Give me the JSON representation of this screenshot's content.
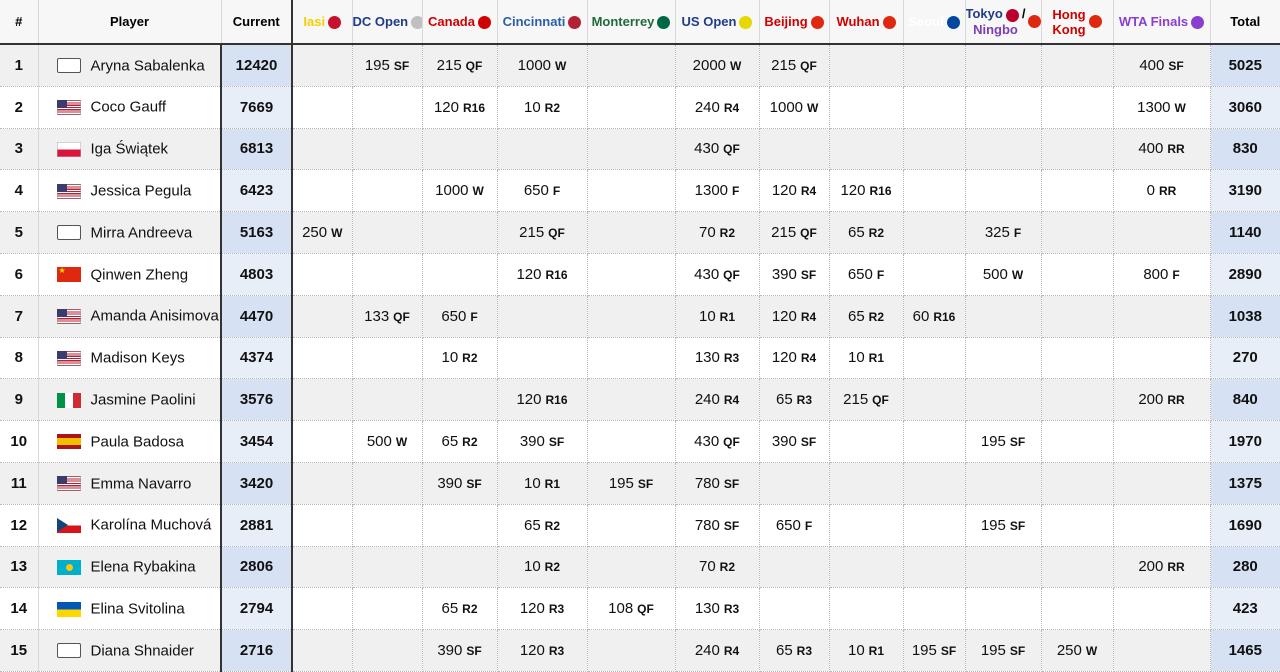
{
  "headers": {
    "rank": "#",
    "player": "Player",
    "current": "Current",
    "total": "Total",
    "events": [
      {
        "name": "Iasi",
        "color": "#f5d000",
        "icon_color": "#c8102e"
      },
      {
        "name": "DC Open",
        "color": "#1f3c88",
        "icon_color": "#c0c0c0"
      },
      {
        "name": "Canada",
        "color": "#d00000",
        "icon_color": "#d00000"
      },
      {
        "name": "Cincinnati",
        "color": "#2b5fa8",
        "icon_color": "#b22234"
      },
      {
        "name": "Monterrey",
        "color": "#1f6b3a",
        "icon_color": "#006847"
      },
      {
        "name": "US Open",
        "color": "#1f3c88",
        "icon_color": "#e6d800"
      },
      {
        "name": "Beijing",
        "color": "#d00000",
        "icon_color": "#de2910"
      },
      {
        "name": "Wuhan",
        "color": "#d00000",
        "icon_color": "#de2910"
      },
      {
        "name": "Seoul",
        "color": "#ffffff",
        "icon_color": "#0047a0"
      },
      {
        "name_top": "Tokyo",
        "name_sep": "/",
        "name_bottom": "Ningbo",
        "color_top": "#1f3c88",
        "color_bottom": "#7b3fb5",
        "icon_top": "#bc002d",
        "icon_bottom": "#de2910"
      },
      {
        "name_top": "Hong",
        "name_bottom": "Kong",
        "color": "#d00000",
        "icon_color": "#de2910"
      },
      {
        "name": "WTA Finals",
        "color": "#8a3fd1",
        "icon_color": "#8a3fd1"
      }
    ]
  },
  "rows": [
    {
      "rank": "1",
      "flag": "blank",
      "name": "Aryna Sabalenka",
      "current": "12420",
      "results": [
        null,
        {
          "pts": "195",
          "rd": "SF"
        },
        {
          "pts": "215",
          "rd": "QF"
        },
        {
          "pts": "1000",
          "rd": "W"
        },
        null,
        {
          "pts": "2000",
          "rd": "W"
        },
        {
          "pts": "215",
          "rd": "QF"
        },
        null,
        null,
        null,
        null,
        {
          "pts": "400",
          "rd": "SF"
        }
      ],
      "total": "5025"
    },
    {
      "rank": "2",
      "flag": "us",
      "name": "Coco Gauff",
      "current": "7669",
      "results": [
        null,
        null,
        {
          "pts": "120",
          "rd": "R16"
        },
        {
          "pts": "10",
          "rd": "R2"
        },
        null,
        {
          "pts": "240",
          "rd": "R4"
        },
        {
          "pts": "1000",
          "rd": "W"
        },
        null,
        null,
        null,
        null,
        {
          "pts": "1300",
          "rd": "W"
        }
      ],
      "total": "3060"
    },
    {
      "rank": "3",
      "flag": "pl",
      "name": "Iga Świątek",
      "current": "6813",
      "results": [
        null,
        null,
        null,
        null,
        null,
        {
          "pts": "430",
          "rd": "QF"
        },
        null,
        null,
        null,
        null,
        null,
        {
          "pts": "400",
          "rd": "RR"
        }
      ],
      "total": "830"
    },
    {
      "rank": "4",
      "flag": "us",
      "name": "Jessica Pegula",
      "current": "6423",
      "results": [
        null,
        null,
        {
          "pts": "1000",
          "rd": "W"
        },
        {
          "pts": "650",
          "rd": "F"
        },
        null,
        {
          "pts": "1300",
          "rd": "F"
        },
        {
          "pts": "120",
          "rd": "R4"
        },
        {
          "pts": "120",
          "rd": "R16"
        },
        null,
        null,
        null,
        {
          "pts": "0",
          "rd": "RR"
        }
      ],
      "total": "3190"
    },
    {
      "rank": "5",
      "flag": "blank",
      "name": "Mirra Andreeva",
      "current": "5163",
      "results": [
        {
          "pts": "250",
          "rd": "W"
        },
        null,
        null,
        {
          "pts": "215",
          "rd": "QF"
        },
        null,
        {
          "pts": "70",
          "rd": "R2"
        },
        {
          "pts": "215",
          "rd": "QF"
        },
        {
          "pts": "65",
          "rd": "R2"
        },
        null,
        {
          "pts": "325",
          "rd": "F"
        },
        null,
        null
      ],
      "total": "1140"
    },
    {
      "rank": "6",
      "flag": "cn",
      "name": "Qinwen Zheng",
      "current": "4803",
      "results": [
        null,
        null,
        null,
        {
          "pts": "120",
          "rd": "R16"
        },
        null,
        {
          "pts": "430",
          "rd": "QF"
        },
        {
          "pts": "390",
          "rd": "SF"
        },
        {
          "pts": "650",
          "rd": "F"
        },
        null,
        {
          "pts": "500",
          "rd": "W"
        },
        null,
        {
          "pts": "800",
          "rd": "F"
        }
      ],
      "total": "2890"
    },
    {
      "rank": "7",
      "flag": "us",
      "name": "Amanda Anisimova",
      "current": "4470",
      "results": [
        null,
        {
          "pts": "133",
          "rd": "QF"
        },
        {
          "pts": "650",
          "rd": "F"
        },
        null,
        null,
        {
          "pts": "10",
          "rd": "R1"
        },
        {
          "pts": "120",
          "rd": "R4"
        },
        {
          "pts": "65",
          "rd": "R2"
        },
        {
          "pts": "60",
          "rd": "R16"
        },
        null,
        null,
        null
      ],
      "total": "1038"
    },
    {
      "rank": "8",
      "flag": "us",
      "name": "Madison Keys",
      "current": "4374",
      "results": [
        null,
        null,
        {
          "pts": "10",
          "rd": "R2"
        },
        null,
        null,
        {
          "pts": "130",
          "rd": "R3"
        },
        {
          "pts": "120",
          "rd": "R4"
        },
        {
          "pts": "10",
          "rd": "R1"
        },
        null,
        null,
        null,
        null
      ],
      "total": "270"
    },
    {
      "rank": "9",
      "flag": "it",
      "name": "Jasmine Paolini",
      "current": "3576",
      "results": [
        null,
        null,
        null,
        {
          "pts": "120",
          "rd": "R16"
        },
        null,
        {
          "pts": "240",
          "rd": "R4"
        },
        {
          "pts": "65",
          "rd": "R3"
        },
        {
          "pts": "215",
          "rd": "QF"
        },
        null,
        null,
        null,
        {
          "pts": "200",
          "rd": "RR"
        }
      ],
      "total": "840"
    },
    {
      "rank": "10",
      "flag": "es",
      "name": "Paula Badosa",
      "current": "3454",
      "results": [
        null,
        {
          "pts": "500",
          "rd": "W"
        },
        {
          "pts": "65",
          "rd": "R2"
        },
        {
          "pts": "390",
          "rd": "SF"
        },
        null,
        {
          "pts": "430",
          "rd": "QF"
        },
        {
          "pts": "390",
          "rd": "SF"
        },
        null,
        null,
        {
          "pts": "195",
          "rd": "SF"
        },
        null,
        null
      ],
      "total": "1970"
    },
    {
      "rank": "11",
      "flag": "us",
      "name": "Emma Navarro",
      "current": "3420",
      "results": [
        null,
        null,
        {
          "pts": "390",
          "rd": "SF"
        },
        {
          "pts": "10",
          "rd": "R1"
        },
        {
          "pts": "195",
          "rd": "SF"
        },
        {
          "pts": "780",
          "rd": "SF"
        },
        null,
        null,
        null,
        null,
        null,
        null
      ],
      "total": "1375"
    },
    {
      "rank": "12",
      "flag": "cz",
      "name": "Karolína Muchová",
      "current": "2881",
      "results": [
        null,
        null,
        null,
        {
          "pts": "65",
          "rd": "R2"
        },
        null,
        {
          "pts": "780",
          "rd": "SF"
        },
        {
          "pts": "650",
          "rd": "F"
        },
        null,
        null,
        {
          "pts": "195",
          "rd": "SF"
        },
        null,
        null
      ],
      "total": "1690"
    },
    {
      "rank": "13",
      "flag": "kz",
      "name": "Elena Rybakina",
      "current": "2806",
      "results": [
        null,
        null,
        null,
        {
          "pts": "10",
          "rd": "R2"
        },
        null,
        {
          "pts": "70",
          "rd": "R2"
        },
        null,
        null,
        null,
        null,
        null,
        {
          "pts": "200",
          "rd": "RR"
        }
      ],
      "total": "280"
    },
    {
      "rank": "14",
      "flag": "ua",
      "name": "Elina Svitolina",
      "current": "2794",
      "results": [
        null,
        null,
        {
          "pts": "65",
          "rd": "R2"
        },
        {
          "pts": "120",
          "rd": "R3"
        },
        {
          "pts": "108",
          "rd": "QF"
        },
        {
          "pts": "130",
          "rd": "R3"
        },
        null,
        null,
        null,
        null,
        null,
        null
      ],
      "total": "423"
    },
    {
      "rank": "15",
      "flag": "blank",
      "name": "Diana Shnaider",
      "current": "2716",
      "results": [
        null,
        null,
        {
          "pts": "390",
          "rd": "SF"
        },
        {
          "pts": "120",
          "rd": "R3"
        },
        null,
        {
          "pts": "240",
          "rd": "R4"
        },
        {
          "pts": "65",
          "rd": "R3"
        },
        {
          "pts": "10",
          "rd": "R1"
        },
        {
          "pts": "195",
          "rd": "SF"
        },
        {
          "pts": "195",
          "rd": "SF"
        },
        {
          "pts": "250",
          "rd": "W"
        },
        null
      ],
      "total": "1465"
    }
  ]
}
